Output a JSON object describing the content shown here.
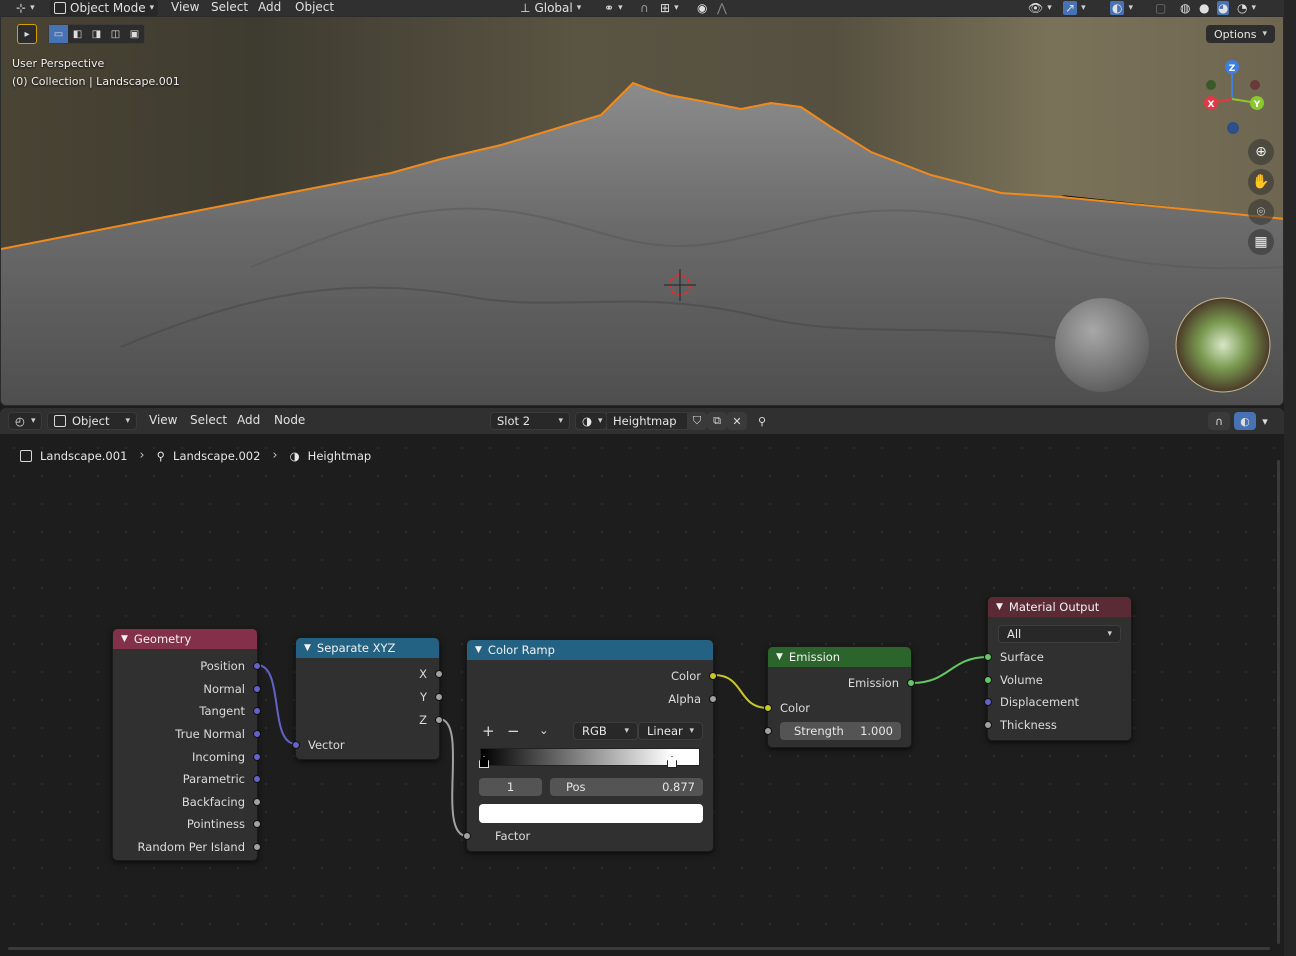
{
  "viewport_header": {
    "mode": "Object Mode",
    "menus": [
      "View",
      "Select",
      "Add",
      "Object"
    ],
    "transform_orientation": "Global"
  },
  "viewport": {
    "perspective_label": "User Perspective",
    "collection_label": "(0) Collection | Landscape.001",
    "options_label": "Options",
    "gizmo": {
      "z": "Z",
      "y": "Y",
      "x": "X"
    },
    "colors": {
      "selection_outline": "#f08a1e",
      "x_axis": "#e03844",
      "y_axis": "#8bc72e",
      "z_axis": "#3d7fe0"
    }
  },
  "node_header": {
    "editor_type": "Object",
    "menus": [
      "View",
      "Select",
      "Add",
      "Node"
    ],
    "slot": "Slot 2",
    "material": "Heightmap"
  },
  "breadcrumb": {
    "object": "Landscape.001",
    "mesh": "Landscape.002",
    "material": "Heightmap"
  },
  "nodes": {
    "geometry": {
      "title": "Geometry",
      "outputs": [
        "Position",
        "Normal",
        "Tangent",
        "True Normal",
        "Incoming",
        "Parametric",
        "Backfacing",
        "Pointiness",
        "Random Per Island"
      ]
    },
    "separate_xyz": {
      "title": "Separate XYZ",
      "outputs": [
        "X",
        "Y",
        "Z"
      ],
      "input": "Vector"
    },
    "color_ramp": {
      "title": "Color Ramp",
      "outputs": [
        "Color",
        "Alpha"
      ],
      "plus": "+",
      "minus": "−",
      "color_mode": "RGB",
      "interpolation": "Linear",
      "stop_index": "1",
      "pos_label": "Pos",
      "pos_value": "0.877",
      "input": "Factor"
    },
    "emission": {
      "title": "Emission",
      "output": "Emission",
      "color_input": "Color",
      "strength_label": "Strength",
      "strength_value": "1.000"
    },
    "material_output": {
      "title": "Material Output",
      "target": "All",
      "inputs": [
        "Surface",
        "Volume",
        "Displacement",
        "Thickness"
      ]
    }
  }
}
